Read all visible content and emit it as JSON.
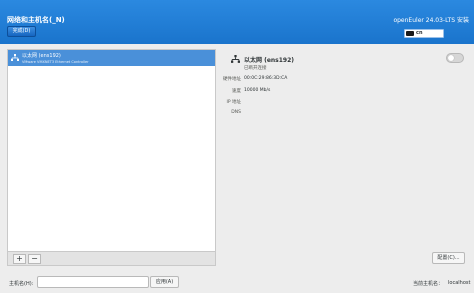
{
  "header": {
    "title": "网络和主机名(_N)",
    "done_label": "完成(D)",
    "product": "openEuler 24.03-LTS 安装",
    "keyboard_layout": "cn"
  },
  "list": {
    "items": [
      {
        "name": "以太网 (ens192)",
        "description": "VMware VMXNET3 Ethernet Controller"
      }
    ],
    "add_label": "+",
    "remove_label": "−"
  },
  "detail": {
    "name": "以太网 (ens192)",
    "state": "已断开连接",
    "toggle_on": false,
    "properties": [
      {
        "label": "硬件地址",
        "value": "00:0C:29:86:3D:CA"
      },
      {
        "label": "速度",
        "value": "10000 Mb/s"
      },
      {
        "label": "IP 地址",
        "value": ""
      },
      {
        "label": "DNS",
        "value": ""
      }
    ],
    "configure_label": "配置(C)..."
  },
  "hostname": {
    "label": "主机名(H):",
    "value": "",
    "apply_label": "应用(A)",
    "current_label": "当前主机名：",
    "current_value": "localhost"
  },
  "colors": {
    "header": "#1a74cc",
    "selection": "#4a90d9"
  }
}
